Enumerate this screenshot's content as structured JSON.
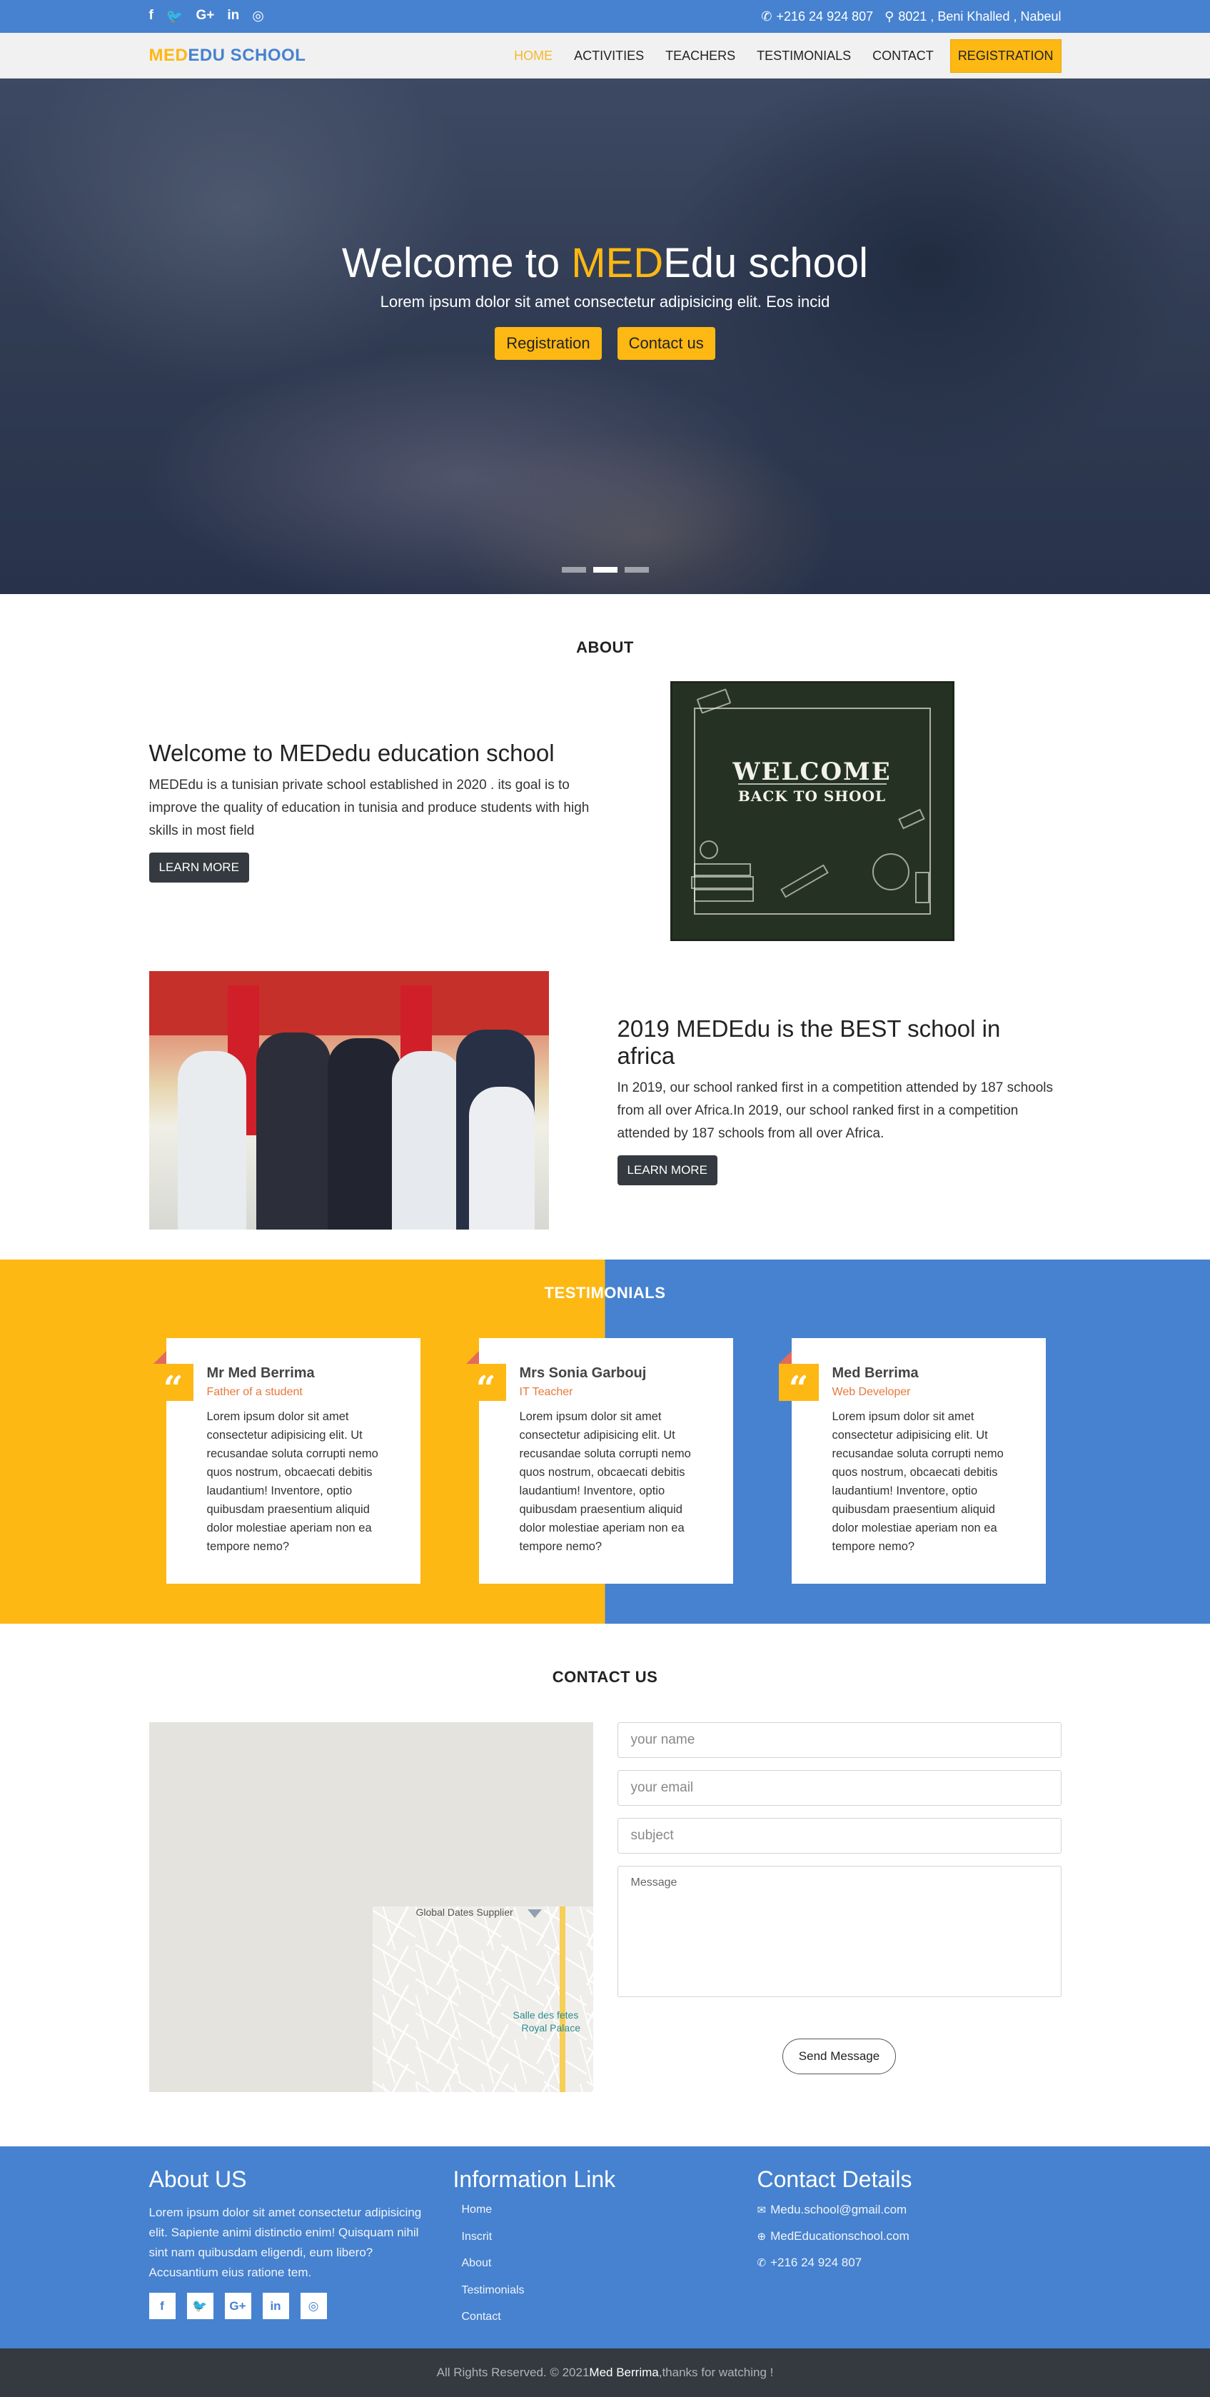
{
  "topbar": {
    "socials": [
      "f",
      "🐦",
      "G+",
      "in",
      "◎"
    ],
    "phone": "+216 24 924 807",
    "address": "8021 , Beni Khalled , Nabeul"
  },
  "navbar": {
    "brand_part1": "MED",
    "brand_part2": "EDU SCHOOL",
    "items": [
      "HOME",
      "ACTIVITIES",
      "TEACHERS",
      "TESTIMONIALS",
      "CONTACT"
    ],
    "registration": "REGISTRATION"
  },
  "hero": {
    "title_prefix": "Welcome to ",
    "title_highlight": "MED",
    "title_suffix": "Edu school",
    "subtitle": "Lorem ipsum dolor sit amet consectetur adipisicing elit. Eos incid",
    "btn_registration": "Registration",
    "btn_contact": "Contact us"
  },
  "about": {
    "title": "ABOUT",
    "block1_heading": "Welcome to MEDedu education school",
    "block1_text": "MEDEdu is a tunisian private school established in 2020 . its goal is to improve the quality of education in tunisia and produce students with high skills in most field",
    "block1_button": "LEARN MORE",
    "chalk_line1": "WELCOME",
    "chalk_line2": "BACK TO SHOOL",
    "block2_heading": "2019 MEDEdu is the BEST school in africa",
    "block2_text": "In 2019, our school ranked first in a competition attended by 187 schools from all over Africa.In 2019, our school ranked first in a competition attended by 187 schools from all over Africa.",
    "block2_button": "LEARN MORE"
  },
  "testimonials": {
    "title": "TESTIMONIALS",
    "items": [
      {
        "name": "Mr Med Berrima",
        "role": "Father of a student",
        "text": "Lorem ipsum dolor sit amet consectetur adipisicing elit. Ut recusandae soluta corrupti nemo quos nostrum, obcaecati debitis laudantium! Inventore, optio quibusdam praesentium aliquid dolor molestiae aperiam non ea tempore nemo?"
      },
      {
        "name": "Mrs Sonia Garbouj",
        "role": "IT Teacher",
        "text": "Lorem ipsum dolor sit amet consectetur adipisicing elit. Ut recusandae soluta corrupti nemo quos nostrum, obcaecati debitis laudantium! Inventore, optio quibusdam praesentium aliquid dolor molestiae aperiam non ea tempore nemo?"
      },
      {
        "name": "Med Berrima",
        "role": "Web Developer",
        "text": "Lorem ipsum dolor sit amet consectetur adipisicing elit. Ut recusandae soluta corrupti nemo quos nostrum, obcaecati debitis laudantium! Inventore, optio quibusdam praesentium aliquid dolor molestiae aperiam non ea tempore nemo?"
      }
    ]
  },
  "contact": {
    "title": "CONTACT US",
    "map_label1": "Global Dates Supplier",
    "map_label2": "Salle des fetes",
    "map_label3": "Royal Palace",
    "name_placeholder": "your name",
    "email_placeholder": "your email",
    "subject_placeholder": "subject",
    "message_placeholder": "Message",
    "send": "Send Message"
  },
  "footer": {
    "about_title": "About US",
    "about_text": "Lorem ipsum dolor sit amet consectetur adipisicing elit. Sapiente animi distinctio enim! Quisquam nihil sint nam quibusdam eligendi, eum libero? Accusantium eius ratione tem.",
    "socials": [
      "f",
      "🐦",
      "G+",
      "in",
      "◎"
    ],
    "links_title": "Information Link",
    "links": [
      "Home",
      "Inscrit",
      "About",
      "Testimonials",
      "Contact"
    ],
    "details_title": "Contact Details",
    "email": "Medu.school@gmail.com",
    "website": "MedEducationschool.com",
    "phone": "+216 24 924 807"
  },
  "bottom": {
    "prefix": "All Rights Reserved. © 2021 ",
    "author": "Med Berrima",
    "suffix": " ,thanks for watching !"
  },
  "colors": {
    "primary_blue": "#4682cf",
    "accent_yellow": "#fdb813",
    "dark": "#343a40"
  }
}
